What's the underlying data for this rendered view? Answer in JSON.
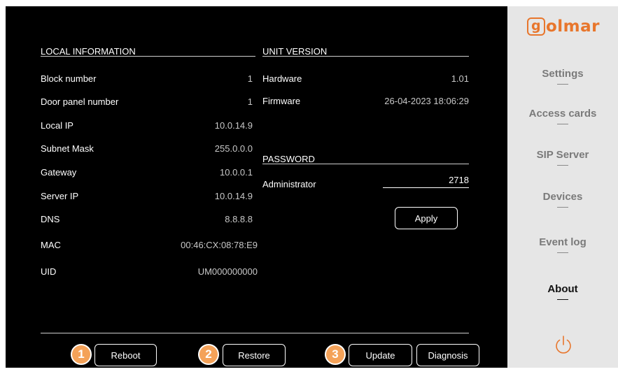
{
  "local_info": {
    "title": "LOCAL INFORMATION",
    "rows": [
      {
        "label": "Block number",
        "value": "1"
      },
      {
        "label": "Door panel number",
        "value": "1"
      },
      {
        "label": "Local IP",
        "value": "10.0.14.9"
      },
      {
        "label": "Subnet Mask",
        "value": "255.0.0.0"
      },
      {
        "label": "Gateway",
        "value": "10.0.0.1"
      },
      {
        "label": "Server IP",
        "value": "10.0.14.9"
      },
      {
        "label": "DNS",
        "value": "8.8.8.8"
      },
      {
        "label": "MAC",
        "value": "00:46:CX:08:78:E9"
      },
      {
        "label": "UID",
        "value": "UM000000000"
      }
    ]
  },
  "unit_version": {
    "title": "UNIT VERSION",
    "rows": [
      {
        "label": "Hardware",
        "value": "1.01"
      },
      {
        "label": "Firmware",
        "value": "26-04-2023 18:06:29"
      }
    ]
  },
  "password": {
    "title": "PASSWORD",
    "label": "Administrator",
    "value": "2718",
    "apply_label": "Apply"
  },
  "footer": {
    "badges": [
      "1",
      "2",
      "3"
    ],
    "reboot_label": "Reboot",
    "restore_label": "Restore",
    "update_label": "Update",
    "diagnosis_label": "Diagnosis"
  },
  "sidebar": {
    "logo_initial": "g",
    "logo_rest": "olmar",
    "items": [
      {
        "label": "Settings",
        "active": false
      },
      {
        "label": "Access cards",
        "active": false
      },
      {
        "label": "SIP Server",
        "active": false
      },
      {
        "label": "Devices",
        "active": false
      },
      {
        "label": "Event log",
        "active": false
      },
      {
        "label": "About",
        "active": true
      }
    ],
    "power_icon": "power-icon"
  },
  "colors": {
    "accent": "#e8762c",
    "badge": "#f4a259",
    "screen_bg": "#000000",
    "sidebar_bg": "#e6e6e6"
  }
}
